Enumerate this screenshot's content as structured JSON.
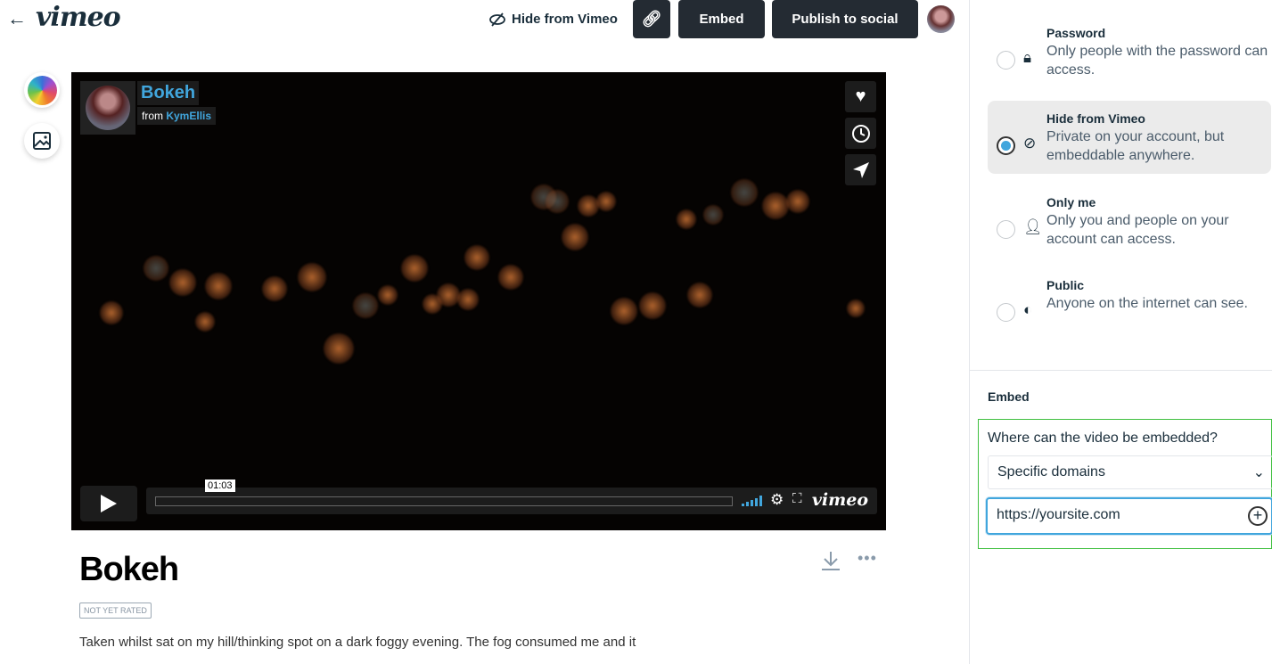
{
  "header": {
    "back_icon": "arrow-left-icon",
    "logo": "vimeo",
    "hide_label": "Hide from Vimeo",
    "link_icon": "link-icon",
    "embed_label": "Embed",
    "publish_label": "Publish to social"
  },
  "player": {
    "title": "Bokeh",
    "from_prefix": "from",
    "author": "KymEllis",
    "time": "01:03",
    "logo": "vimeo",
    "accent": "#41a6dd"
  },
  "video": {
    "title": "Bokeh",
    "rating": "NOT YET RATED",
    "description": "Taken whilst sat on my hill/thinking spot on a dark foggy evening. The fog consumed me and it"
  },
  "privacy": {
    "options": [
      {
        "title": "Password",
        "desc": "Only people with the password can access.",
        "icon": "lock-icon",
        "selected": false
      },
      {
        "title": "Hide from Vimeo",
        "desc": "Private on your account, but embeddable anywhere.",
        "icon": "eye-slash-icon",
        "selected": true
      },
      {
        "title": "Only me",
        "desc": "Only you and people on your account can access.",
        "icon": "user-icon",
        "selected": false
      },
      {
        "title": "Public",
        "desc": "Anyone on the internet can see.",
        "icon": "globe-icon",
        "selected": false
      }
    ]
  },
  "embed": {
    "label": "Embed",
    "question": "Where can the video be embedded?",
    "select_value": "Specific domains",
    "domain_value": "https://yoursite.com"
  }
}
